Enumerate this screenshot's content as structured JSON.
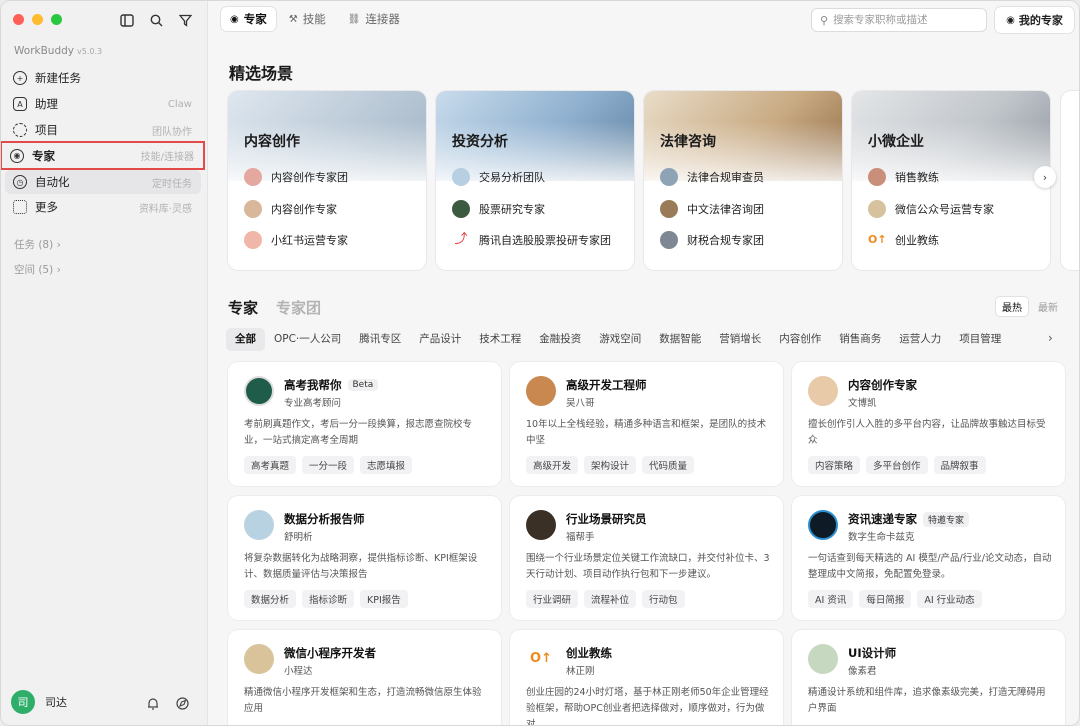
{
  "sidebar": {
    "app_name": "WorkBuddy",
    "version": "v5.0.3",
    "nav": [
      {
        "label": "新建任务",
        "hint": "",
        "icon": "plus-circle-icon"
      },
      {
        "label": "助理",
        "hint": "Claw",
        "icon": "robot-icon"
      },
      {
        "label": "项目",
        "hint": "团队协作",
        "icon": "cloud-icon"
      },
      {
        "label": "专家",
        "hint": "技能/连接器",
        "icon": "expert-icon"
      },
      {
        "label": "自动化",
        "hint": "定时任务",
        "icon": "alarm-icon"
      },
      {
        "label": "更多",
        "hint": "资料库·灵感",
        "icon": "grid-icon"
      }
    ],
    "groups": [
      "任务 (8)",
      "空间 (5)"
    ],
    "user_name": "司达",
    "user_initial": "司"
  },
  "header": {
    "tabs": [
      {
        "label": "专家",
        "icon": "expert-icon"
      },
      {
        "label": "技能",
        "icon": "skill-icon"
      },
      {
        "label": "连接器",
        "icon": "link-icon"
      }
    ],
    "search_placeholder": "搜索专家职称或描述",
    "my_experts": "我的专家"
  },
  "scenes": {
    "title": "精选场景",
    "cards": [
      {
        "title": "内容创作",
        "items": [
          "内容创作专家团",
          "内容创作专家",
          "小红书运营专家"
        ]
      },
      {
        "title": "投资分析",
        "items": [
          "交易分析团队",
          "股票研究专家",
          "腾讯自选股股票投研专家团"
        ]
      },
      {
        "title": "法律咨询",
        "items": [
          "法律合规审查员",
          "中文法律咨询团",
          "财税合规专家团"
        ]
      },
      {
        "title": "小微企业",
        "items": [
          "销售教练",
          "微信公众号运营专家",
          "创业教练"
        ]
      }
    ]
  },
  "experts": {
    "title": "专家",
    "title_alt": "专家团",
    "sort": [
      "最热",
      "最新"
    ],
    "categories": [
      "全部",
      "OPC·一人公司",
      "腾讯专区",
      "产品设计",
      "技术工程",
      "金融投资",
      "游戏空间",
      "数据智能",
      "营销增长",
      "内容创作",
      "销售商务",
      "运营人力",
      "项目管理"
    ],
    "cards": [
      {
        "name": "高考我帮你",
        "badge": "Beta",
        "sub": "专业高考顾问",
        "desc": "考前刷真题作文，考后一分一段换算，报志愿查院校专业，一站式搞定高考全周期",
        "tags": [
          "高考真题",
          "一分一段",
          "志愿填报"
        ]
      },
      {
        "name": "高级开发工程师",
        "badge": "",
        "sub": "吴八哥",
        "desc": "10年以上全栈经验，精通多种语言和框架，是团队的技术中坚",
        "tags": [
          "高级开发",
          "架构设计",
          "代码质量"
        ]
      },
      {
        "name": "内容创作专家",
        "badge": "",
        "sub": "文博凯",
        "desc": "擅长创作引人入胜的多平台内容，让品牌故事触达目标受众",
        "tags": [
          "内容策略",
          "多平台创作",
          "品牌叙事"
        ]
      },
      {
        "name": "数据分析报告师",
        "badge": "",
        "sub": "舒明析",
        "desc": "将复杂数据转化为战略洞察，提供指标诊断、KPI框架设计、数据质量评估与决策报告",
        "tags": [
          "数据分析",
          "指标诊断",
          "KPI报告"
        ]
      },
      {
        "name": "行业场景研究员",
        "badge": "",
        "sub": "福帮手",
        "desc": "围绕一个行业场景定位关键工作流缺口，并交付补位卡、3天行动计划、项目动作执行包和下一步建议。",
        "tags": [
          "行业调研",
          "流程补位",
          "行动包"
        ]
      },
      {
        "name": "资讯速递专家",
        "badge": "特邀专家",
        "sub": "数字生命卡兹克",
        "desc": "一句话查到每天精选的 AI 模型/产品/行业/论文动态，自动整理成中文简报，免配置免登录。",
        "tags": [
          "AI 资讯",
          "每日简报",
          "AI 行业动态"
        ]
      },
      {
        "name": "微信小程序开发者",
        "badge": "",
        "sub": "小程达",
        "desc": "精通微信小程序开发框架和生态，打造流畅微信原生体验应用",
        "tags": []
      },
      {
        "name": "创业教练",
        "badge": "",
        "sub": "林正刚",
        "desc": "创业庄园的24小时灯塔，基于林正刚老师50年企业管理经验框架，帮助OPC创业者把选择做对，顺序做对，行为做对...",
        "tags": []
      },
      {
        "name": "UI设计师",
        "badge": "",
        "sub": "像素君",
        "desc": "精通设计系统和组件库，追求像素级完美，打造无障碍用户界面",
        "tags": []
      }
    ]
  },
  "colors": {
    "accent_red": "#e34a4a",
    "selected_tab": "#ffffff",
    "traffic_red": "#fe5f57",
    "traffic_yellow": "#febc2e",
    "traffic_green": "#28c840"
  }
}
